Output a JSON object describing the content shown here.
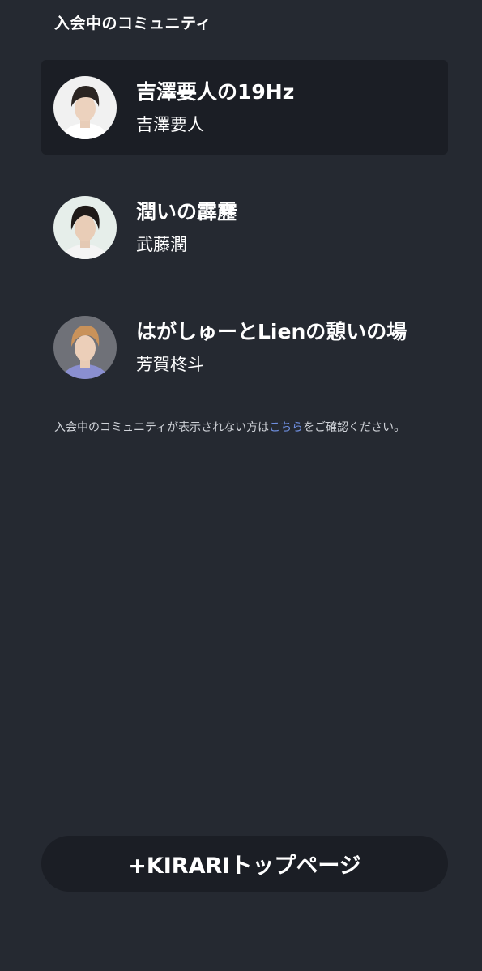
{
  "header": {
    "title": "入会中のコミュニティ"
  },
  "communities": [
    {
      "name": "吉澤要人の19Hz",
      "owner": "吉澤要人",
      "active": true
    },
    {
      "name": "潤いの霹靂",
      "owner": "武藤潤",
      "active": false
    },
    {
      "name": "はがしゅーとLienの憩いの場",
      "owner": "芳賀柊斗",
      "active": false
    }
  ],
  "notice": {
    "before": "入会中のコミュニティが表示されない方は",
    "link": "こちら",
    "after": "をご確認ください。"
  },
  "footer": {
    "top_button_label": "+KIRARIトップページ"
  },
  "colors": {
    "background": "#252931",
    "card": "#1b1e25",
    "link": "#6f8fe0",
    "text": "#ffffff"
  }
}
